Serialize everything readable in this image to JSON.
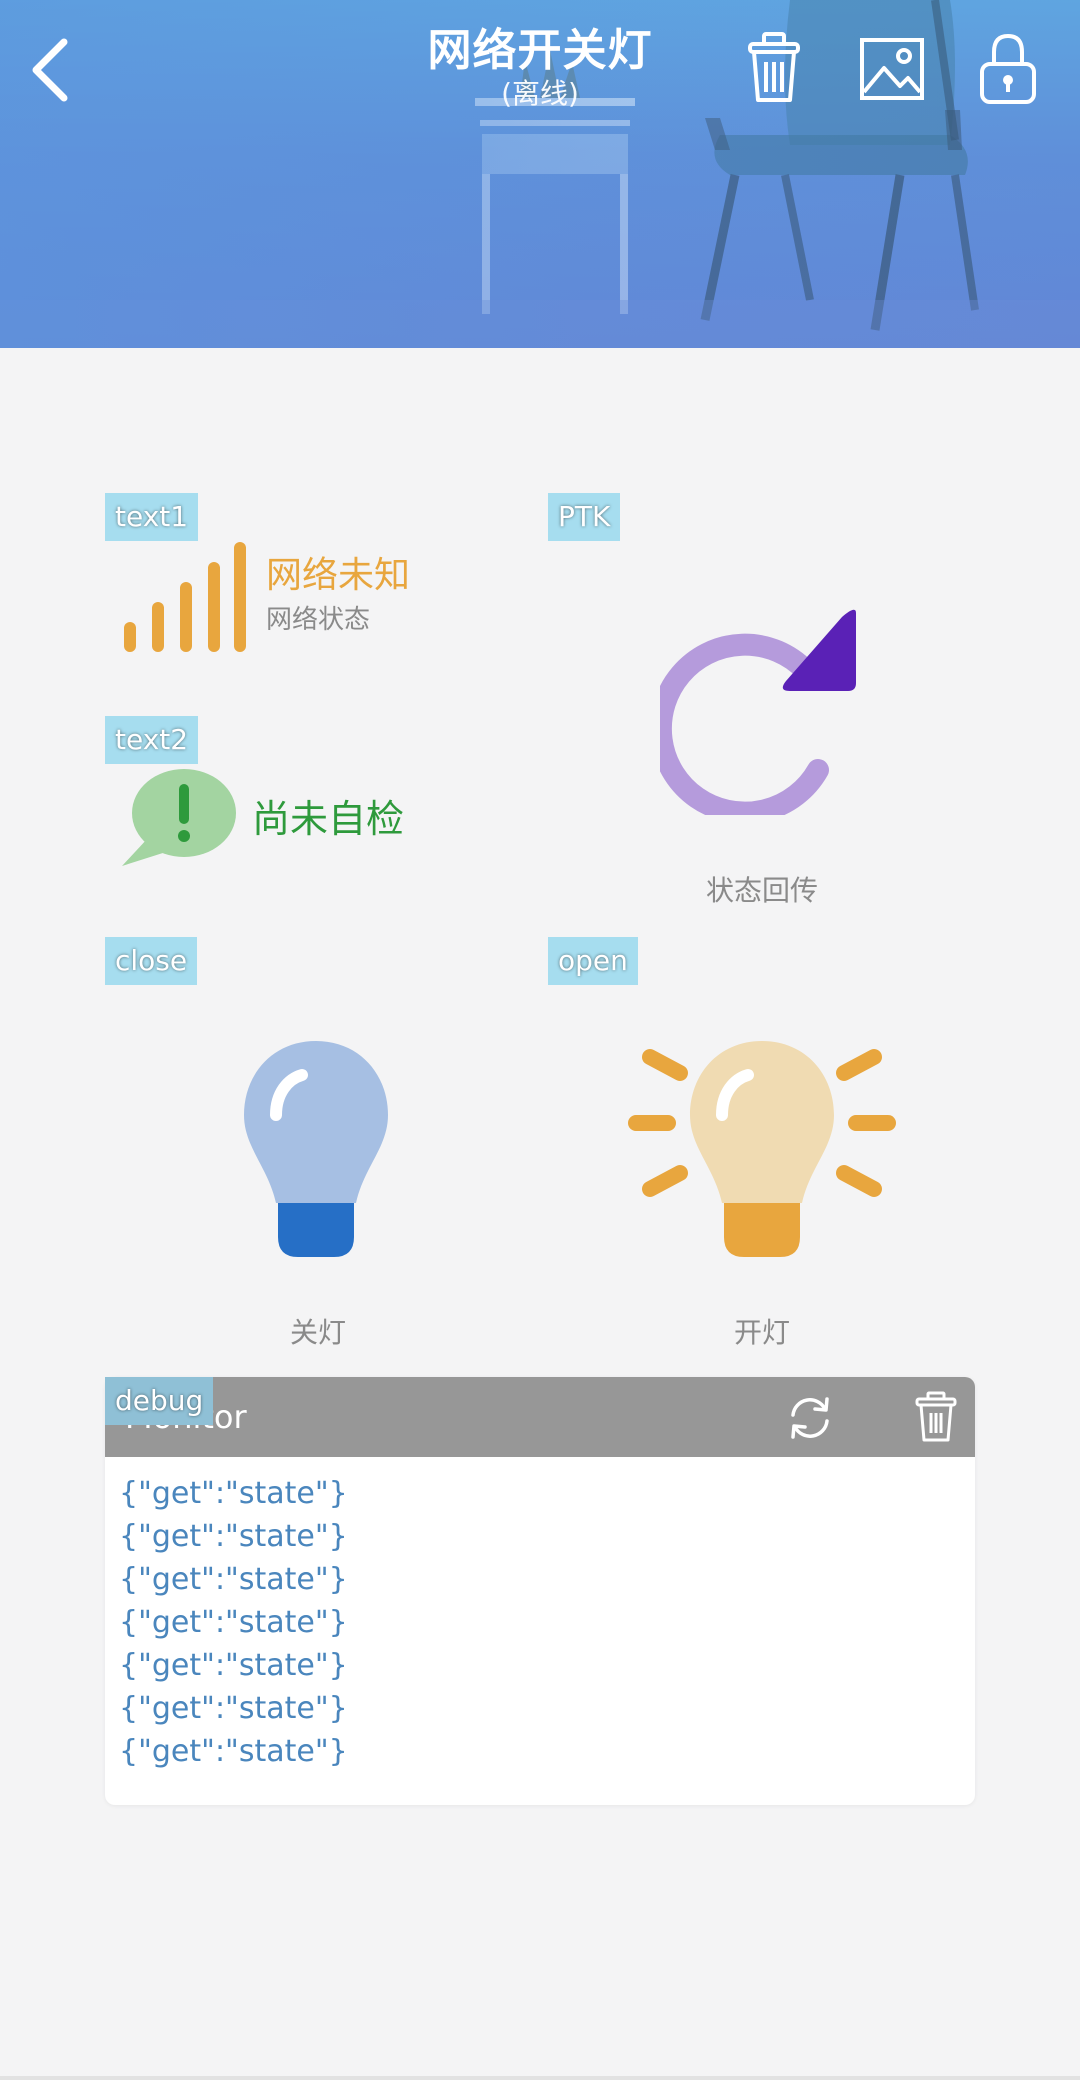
{
  "header": {
    "title": "网络开关灯",
    "subtitle": "(离线)"
  },
  "widgets": {
    "text1": {
      "tag": "text1",
      "status": "网络未知",
      "caption": "网络状态"
    },
    "text2": {
      "tag": "text2",
      "status": "尚未自检"
    },
    "ptk": {
      "tag": "PTK",
      "label": "状态回传"
    },
    "close": {
      "tag": "close",
      "label": "关灯"
    },
    "open": {
      "tag": "open",
      "label": "开灯"
    },
    "debug": {
      "tag": "debug",
      "title": "Monitor",
      "log": [
        "{\"get\":\"state\"}",
        "{\"get\":\"state\"}",
        "{\"get\":\"state\"}",
        "{\"get\":\"state\"}",
        "{\"get\":\"state\"}",
        "{\"get\":\"state\"}",
        "{\"get\":\"state\"}"
      ]
    }
  },
  "icons": {
    "back": "chevron-left-icon",
    "delete": "trash-icon",
    "background": "image-icon",
    "lock": "lock-icon",
    "signal": "signal-bars-icon",
    "selfcheck": "alert-bubble-icon",
    "refresh": "refresh-icon",
    "bulb_off": "bulb-off-icon",
    "bulb_on": "bulb-on-icon"
  },
  "colors": {
    "accent_orange": "#e8a63e",
    "accent_green": "#2e9a3c",
    "refresh_light": "#b59bdc",
    "refresh_dark": "#5a21b6",
    "bulb_off": "#a6bfe3",
    "bulb_off_base": "#266fc6",
    "bulb_on": "#f0dbb2",
    "bulb_on_base": "#e8a63e",
    "log_text": "#4a86bd"
  }
}
